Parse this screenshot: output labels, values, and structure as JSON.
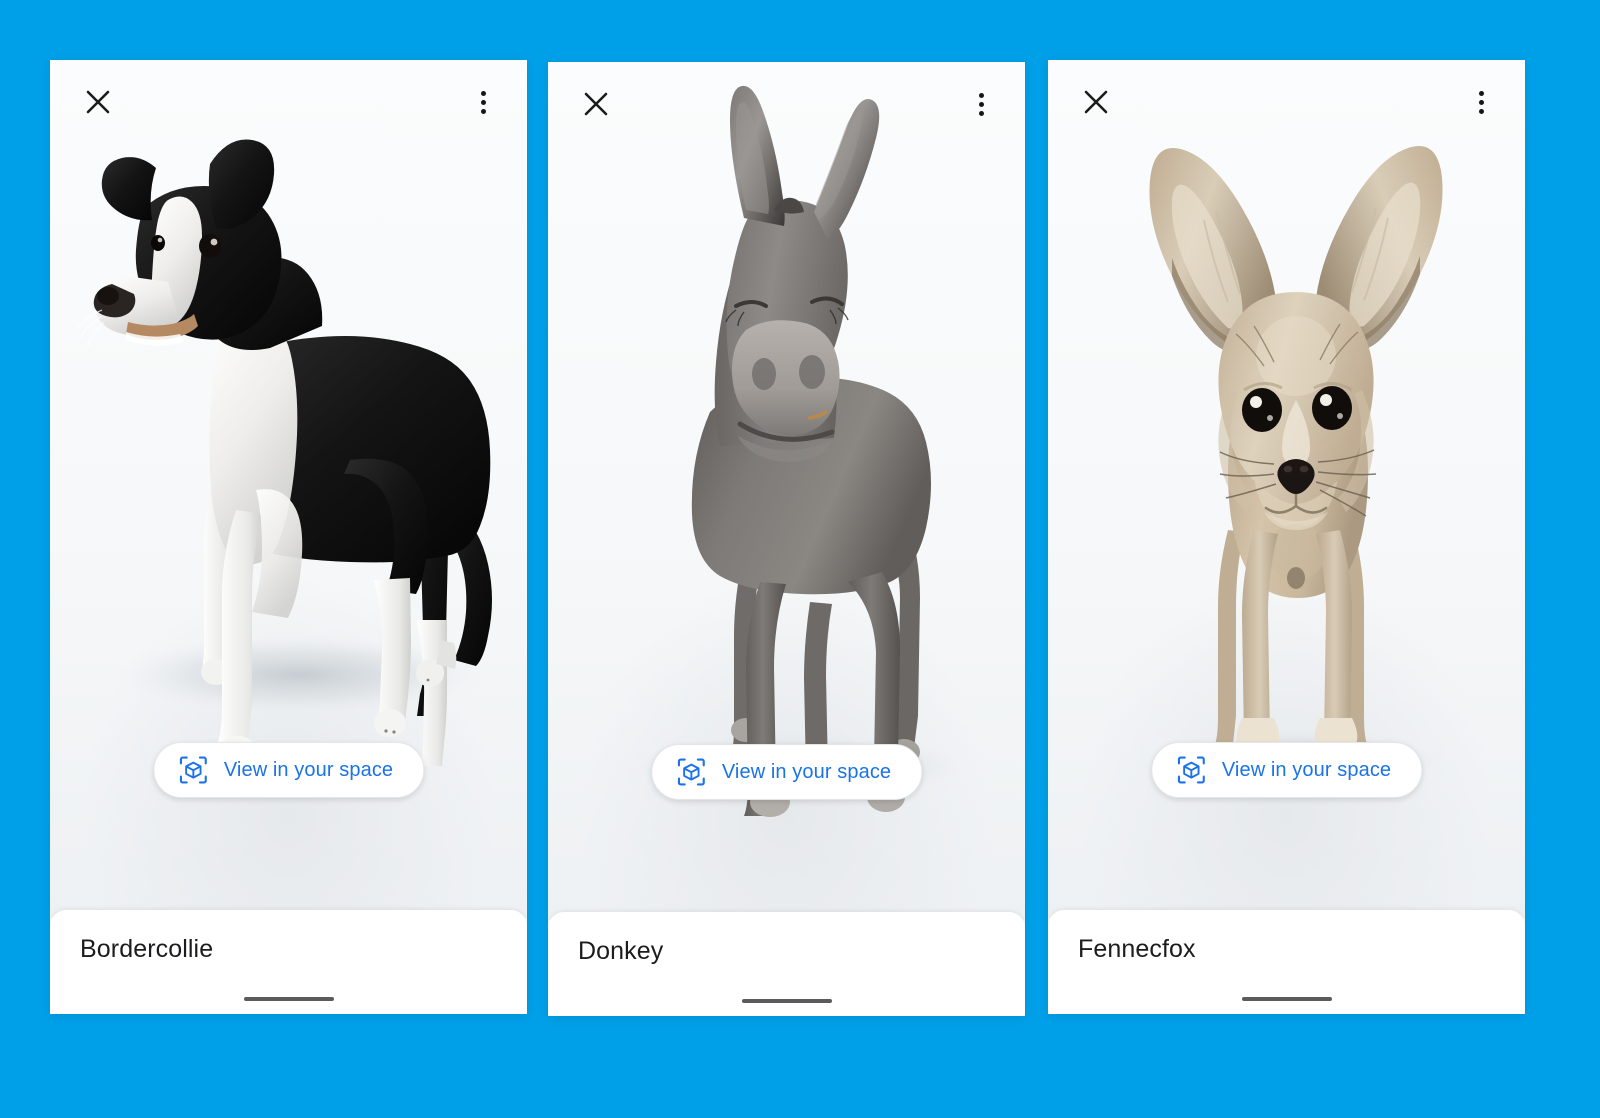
{
  "background_color": "#00a0e9",
  "accent_color": "#1a73e8",
  "cards": [
    {
      "title": "Bordercollie",
      "ar_button_label": "View in your space",
      "close_label": "Close",
      "menu_label": "More options",
      "model": "border-collie-dog",
      "model_description": "Black and white Border Collie dog standing, facing left",
      "colors": {
        "fur_dark": "#1a1a1a",
        "fur_light": "#f2f2f0",
        "ground_shadow": "#d5d9dc"
      }
    },
    {
      "title": "Donkey",
      "ar_button_label": "View in your space",
      "close_label": "Close",
      "menu_label": "More options",
      "model": "donkey",
      "model_description": "Grey donkey standing, facing forward with long ears",
      "colors": {
        "body": "#7b7876",
        "body_dark": "#5a5755",
        "muzzle": "#b9b5b1",
        "ground_shadow": "#d5d9dc"
      }
    },
    {
      "title": "Fennecfox",
      "ar_button_label": "View in your space",
      "close_label": "Close",
      "menu_label": "More options",
      "model": "fennec-fox",
      "model_description": "Tan fennec fox standing, facing forward with very large ears",
      "colors": {
        "body": "#cbb79e",
        "body_light": "#e5dbcb",
        "inner_ear": "#d8cdbd",
        "ground_shadow": "#d5d9dc"
      }
    }
  ],
  "icons": {
    "close": "close-icon",
    "menu": "more-vert-icon",
    "ar": "ar-cube-icon"
  }
}
